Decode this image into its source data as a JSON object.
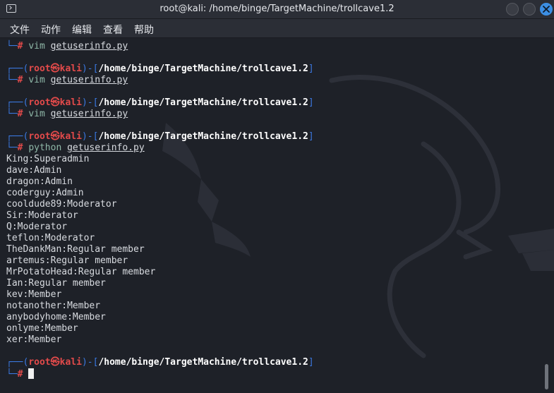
{
  "window": {
    "title": "root@kali: /home/binge/TargetMachine/trollcave1.2"
  },
  "menu": {
    "items": [
      "文件",
      "动作",
      "编辑",
      "查看",
      "帮助"
    ]
  },
  "prompt": {
    "corner_top": "┌──(",
    "user": "root",
    "skull": "㉿",
    "host": "kali",
    "sep": ")-[",
    "path": "/home/binge/TargetMachine/trollcave1.2",
    "close": "]",
    "corner_bottom": "└─",
    "hash": "#"
  },
  "commands": {
    "c0_cmd": "vim",
    "c0_arg": "getuserinfo.py",
    "c1_cmd": "vim",
    "c1_arg": "getuserinfo.py",
    "c2_cmd": "vim",
    "c2_arg": "getuserinfo.py",
    "c3_cmd": "python",
    "c3_arg": "getuserinfo.py"
  },
  "output": [
    "King:Superadmin",
    "dave:Admin",
    "dragon:Admin",
    "coderguy:Admin",
    "cooldude89:Moderator",
    "Sir:Moderator",
    "Q:Moderator",
    "teflon:Moderator",
    "TheDankMan:Regular member",
    "artemus:Regular member",
    "MrPotatoHead:Regular member",
    "Ian:Regular member",
    "kev:Member",
    "notanother:Member",
    "anybodyhome:Member",
    "onlyme:Member",
    "xer:Member"
  ],
  "icons": {
    "app": "terminal-icon",
    "minimize": "minimize-icon",
    "maximize": "maximize-icon",
    "close": "close-icon"
  },
  "colors": {
    "prompt_frame": "#3a78e0",
    "user_host": "#e24a4a",
    "path": "#ffffff",
    "command": "#8fb8a8",
    "close_button": "#3c8fe4",
    "background": "#1e2128"
  }
}
